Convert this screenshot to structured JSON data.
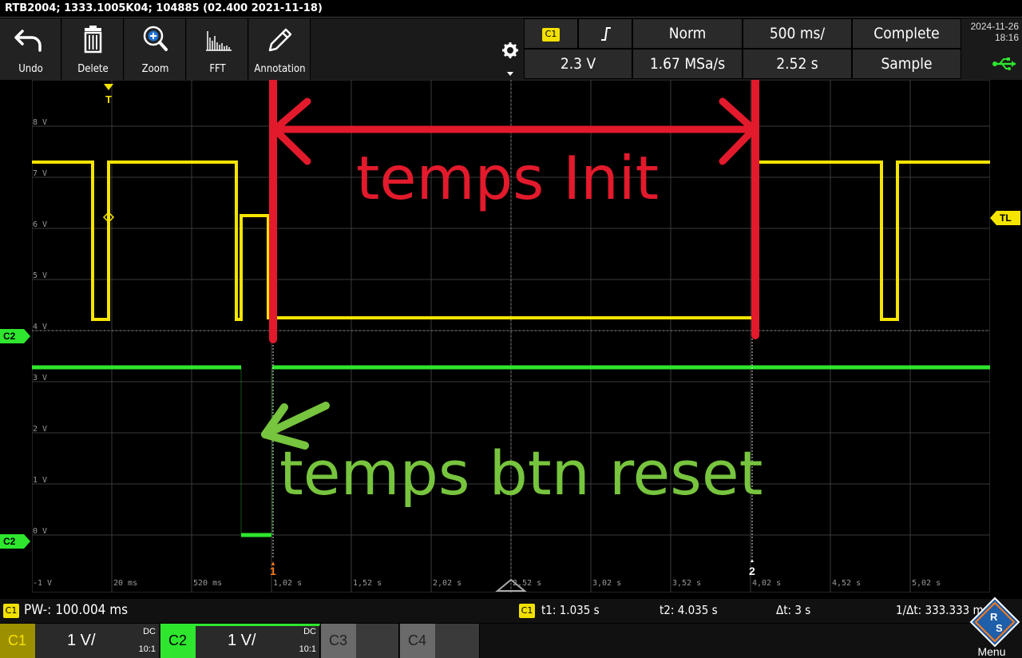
{
  "device_info": "RTB2004; 1333.1005K04; 104885 (02.400 2021-11-18)",
  "toolbar": {
    "buttons": [
      {
        "label": "Undo",
        "icon": "undo-arrow-icon"
      },
      {
        "label": "Delete",
        "icon": "trash-icon"
      },
      {
        "label": "Zoom",
        "icon": "zoom-plus-icon"
      },
      {
        "label": "FFT",
        "icon": "fft-spectrum-icon"
      },
      {
        "label": "Annotation",
        "icon": "pencil-icon"
      }
    ],
    "settings_icon": "gear-icon"
  },
  "trigger": {
    "source": "C1",
    "slope_icon": "rising-edge-icon",
    "mode": "Norm",
    "timebase": "500 ms/",
    "acq_state": "Complete",
    "level": "2.3 V",
    "sample_rate": "1.67 MSa/s",
    "record_time": "2.52 s",
    "acq_mode": "Sample"
  },
  "datetime": {
    "date": "2024-11-26",
    "time": "18:16"
  },
  "usb_icon": "usb-icon",
  "screen": {
    "y_labels": [
      "8 V",
      "7 V",
      "6 V",
      "5 V",
      "4 V",
      "3 V",
      "2 V",
      "1 V",
      "0 V",
      "-1 V"
    ],
    "x_labels": [
      "20 ms",
      "520 ms",
      "1,02 s",
      "1,52 s",
      "2,02 s",
      "2,52 s",
      "3,02 s",
      "3,52 s",
      "4,02 s",
      "4,52 s",
      "5,02 s"
    ],
    "trigger_marker": "T",
    "trigger_level_marker": "TL",
    "c2_offset_marker": "C2",
    "c2_ground_marker": "C2",
    "cursor1_label": "1",
    "cursor2_label": "2",
    "colors": {
      "ch1": "#f5e400",
      "ch2": "#2ee62e",
      "annot_red": "#e21a2c",
      "annot_green": "#77c43e",
      "grid": "#3a3a3a"
    }
  },
  "annotations": {
    "init_text": "temps Init",
    "reset_text": "temps btn reset"
  },
  "status": {
    "channel": "C1",
    "measurement": "PW-: 100.004 ms",
    "cursor_channel": "C1",
    "t1": "t1: 1.035 s",
    "t2": "t2: 4.035 s",
    "dt": "Δt: 3 s",
    "inv_dt": "1/Δt: 333.333 m"
  },
  "channels": [
    {
      "name": "C1",
      "scale": "1 V/",
      "coupling": "DC",
      "ratio": "10:1",
      "color": "#f5e400"
    },
    {
      "name": "C2",
      "scale": "1 V/",
      "coupling": "DC",
      "ratio": "10:1",
      "color": "#2ee62e"
    },
    {
      "name": "C3"
    },
    {
      "name": "C4"
    }
  ],
  "menu": {
    "label": "Menu",
    "logo": "rohde-schwarz-logo"
  }
}
